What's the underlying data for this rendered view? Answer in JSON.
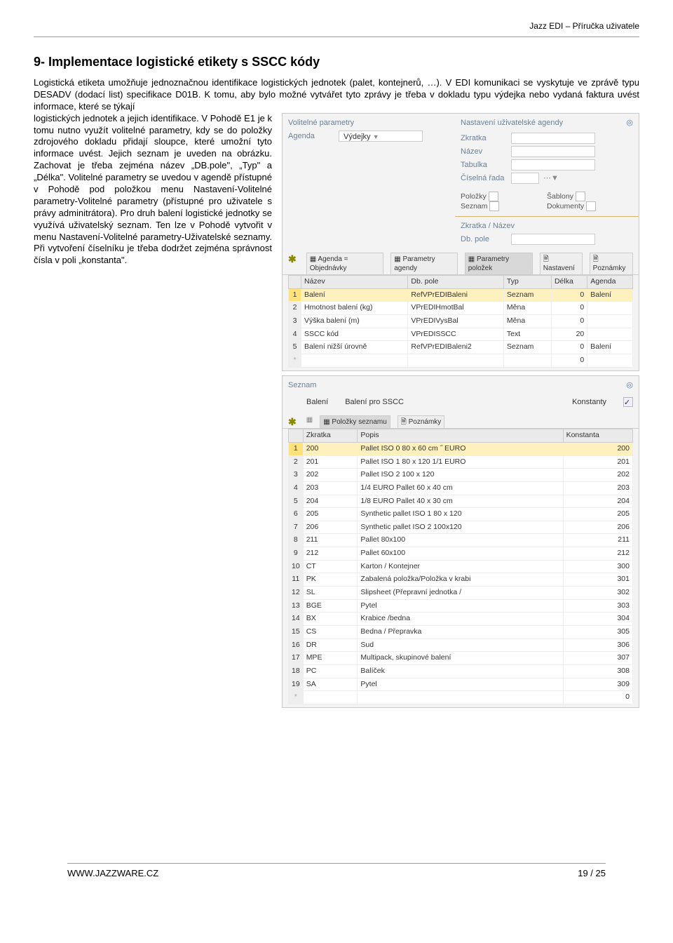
{
  "header": {
    "title": "Jazz EDI – Příručka uživatele"
  },
  "section": {
    "heading": "9- Implementace logistické etikety s SSCC kódy"
  },
  "intro": "Logistická etiketa umožňuje jednoznačnou identifikace logistických jednotek (palet, kontejnerů, …). V EDI komunikaci se vyskytuje ve zprávě typu DESADV (dodací list) specifikace D01B. K tomu, aby bylo možné vytvářet tyto zprávy je třeba v dokladu typu výdejka nebo vydaná faktura uvést informace, které se týkají",
  "leftText": "logistických jednotek a jejich identifikace. V Pohodě E1 je k tomu nutno využít volitelné parametry, kdy se do položky zdrojového dokladu přidají sloupce, které umožní tyto informace uvést. Jejich seznam je uveden na obrázku. Zachovat je třeba zejména název „DB.pole\", „Typ\" a „Délka\". Volitelné parametry se uvedou v agendě přístupné v Pohodě pod položkou menu Nastavení-Volitelné parametry-Volitelné parametry (přístupné pro uživatele s právy adminitrátora). Pro druh balení logistické jednotky se využívá uživatelský seznam. Ten lze v Pohodě vytvořit v menu Nastavení-Volitelné parametry-Uživatelské seznamy. Při vytvoření číselníku je třeba dodržet zejména správnost čísla v poli „konstanta\".",
  "shot1": {
    "leftTitle": "Volitelné parametry",
    "rightTitle": "Nastavení uživatelské agendy",
    "agendaLbl": "Agenda",
    "agendaVal": "Výdejky",
    "field1": "Zkratka",
    "field2": "Název",
    "field3": "Tabulka",
    "field4": "Číselná řada",
    "opt1": "Položky",
    "opt2": "Seznam",
    "opt3": "Šablony",
    "opt4": "Dokumenty",
    "group1": "Zkratka / Název",
    "group2": "Db. pole",
    "tabs": [
      "Agenda = Objednávky",
      "Parametry agendy",
      "Parametry položek",
      "Nastavení",
      "Poznámky"
    ],
    "cols": [
      "",
      "Název",
      "Db. pole",
      "Typ",
      "Délka",
      "Agenda"
    ],
    "rows": [
      {
        "n": "1",
        "nazev": "Balení",
        "db": "RefVPrEDIBaleni",
        "typ": "Seznam",
        "delka": "0",
        "ag": "Balení"
      },
      {
        "n": "2",
        "nazev": "Hmotnost balení (kg)",
        "db": "VPrEDIHmotBal",
        "typ": "Měna",
        "delka": "0",
        "ag": ""
      },
      {
        "n": "3",
        "nazev": "Výška balení (m)",
        "db": "VPrEDIVysBal",
        "typ": "Měna",
        "delka": "0",
        "ag": ""
      },
      {
        "n": "4",
        "nazev": "SSCC kód",
        "db": "VPrEDISSCC",
        "typ": "Text",
        "delka": "20",
        "ag": ""
      },
      {
        "n": "5",
        "nazev": "Balení nižší úrovně",
        "db": "RefVPrEDIBaleni2",
        "typ": "Seznam",
        "delka": "0",
        "ag": "Balení"
      },
      {
        "n": "*",
        "nazev": "",
        "db": "",
        "typ": "",
        "delka": "0",
        "ag": ""
      }
    ]
  },
  "shot2": {
    "title": "Seznam",
    "nameLbl": "Balení",
    "subLbl": "Balení pro SSCC",
    "konstLbl": "Konstanty",
    "tabs": [
      "Položky seznamu",
      "Poznámky"
    ],
    "cols": [
      "",
      "Zkratka",
      "Popis",
      "Konstanta"
    ],
    "rows": [
      {
        "n": "1",
        "z": "200",
        "p": "Pallet ISO 0 80 x 60 cm ˝ EURO",
        "k": "200"
      },
      {
        "n": "2",
        "z": "201",
        "p": "Pallet ISO 1 80 x 120 1/1 EURO",
        "k": "201"
      },
      {
        "n": "3",
        "z": "202",
        "p": "Pallet ISO 2 100 x 120",
        "k": "202"
      },
      {
        "n": "4",
        "z": "203",
        "p": "1/4 EURO Pallet 60 x 40 cm",
        "k": "203"
      },
      {
        "n": "5",
        "z": "204",
        "p": "1/8 EURO Pallet 40 x 30 cm",
        "k": "204"
      },
      {
        "n": "6",
        "z": "205",
        "p": "Synthetic pallet ISO 1 80 x 120",
        "k": "205"
      },
      {
        "n": "7",
        "z": "206",
        "p": "Synthetic pallet ISO 2 100x120",
        "k": "206"
      },
      {
        "n": "8",
        "z": "211",
        "p": "Pallet 80x100",
        "k": "211"
      },
      {
        "n": "9",
        "z": "212",
        "p": "Pallet 60x100",
        "k": "212"
      },
      {
        "n": "10",
        "z": "CT",
        "p": "Karton / Kontejner",
        "k": "300"
      },
      {
        "n": "11",
        "z": "PK",
        "p": "Zabalená položka/Položka v krabi",
        "k": "301"
      },
      {
        "n": "12",
        "z": "SL",
        "p": "Slipsheet (Přepravní jednotka /",
        "k": "302"
      },
      {
        "n": "13",
        "z": "BGE",
        "p": "Pytel",
        "k": "303"
      },
      {
        "n": "14",
        "z": "BX",
        "p": "Krabice /bedna",
        "k": "304"
      },
      {
        "n": "15",
        "z": "CS",
        "p": "Bedna / Přepravka",
        "k": "305"
      },
      {
        "n": "16",
        "z": "DR",
        "p": "Sud",
        "k": "306"
      },
      {
        "n": "17",
        "z": "MPE",
        "p": "Multipack, skupinové balení",
        "k": "307"
      },
      {
        "n": "18",
        "z": "PC",
        "p": "Balíček",
        "k": "308"
      },
      {
        "n": "19",
        "z": "SA",
        "p": "Pytel",
        "k": "309"
      },
      {
        "n": "*",
        "z": "",
        "p": "",
        "k": "0"
      }
    ]
  },
  "footer": {
    "url": "WWW.JAZZWARE.CZ",
    "page": "19 / 25"
  }
}
